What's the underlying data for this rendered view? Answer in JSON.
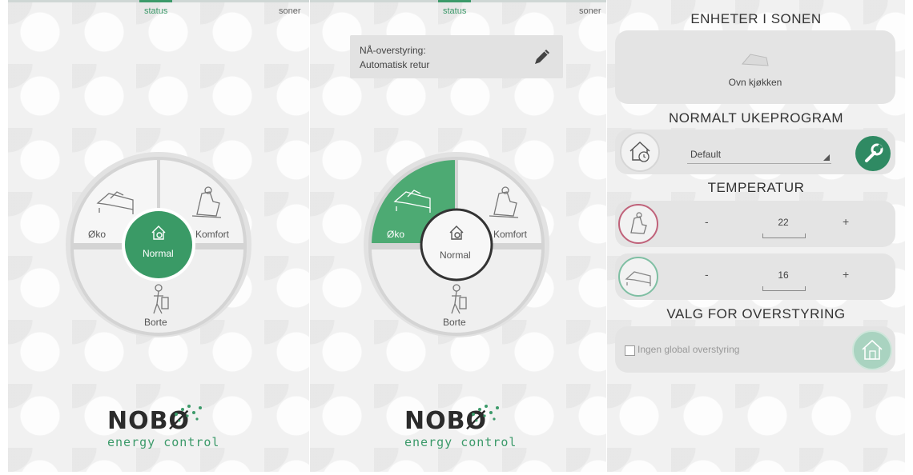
{
  "screens": [
    {
      "tabs": {
        "status": "status",
        "soner": "soner"
      },
      "dial": {
        "eco": "Øko",
        "comfort": "Komfort",
        "away": "Borte",
        "normal": "Normal",
        "active": "normal"
      },
      "logo": {
        "brand": "NOBØ",
        "tagline": "energy control"
      }
    },
    {
      "tabs": {
        "status": "status",
        "soner": "soner"
      },
      "override": {
        "line1": "NÅ-overstyring:",
        "line2": "Automatisk retur"
      },
      "dial": {
        "eco": "Øko",
        "comfort": "Komfort",
        "away": "Borte",
        "normal": "Normal",
        "active": "eco"
      },
      "logo": {
        "brand": "NOBØ",
        "tagline": "energy control"
      }
    }
  ],
  "zone": {
    "units_heading": "ENHETER I SONEN",
    "unit_name": "Ovn kjøkken",
    "weekly_heading": "NORMALT UKEPROGRAM",
    "weekly_selected": "Default",
    "temp_heading": "TEMPERATUR",
    "comfort_temp": "22",
    "eco_temp": "16",
    "minus": "-",
    "plus": "+",
    "override_heading": "VALG FOR OVERSTYRING",
    "override_option": "Ingen global overstyring",
    "override_checked": false
  },
  "colors": {
    "accent": "#3c9a6a",
    "accent_dark": "#2f8a63",
    "comfort_ring": "#c0627a",
    "eco_ring": "#7fbfa3"
  }
}
